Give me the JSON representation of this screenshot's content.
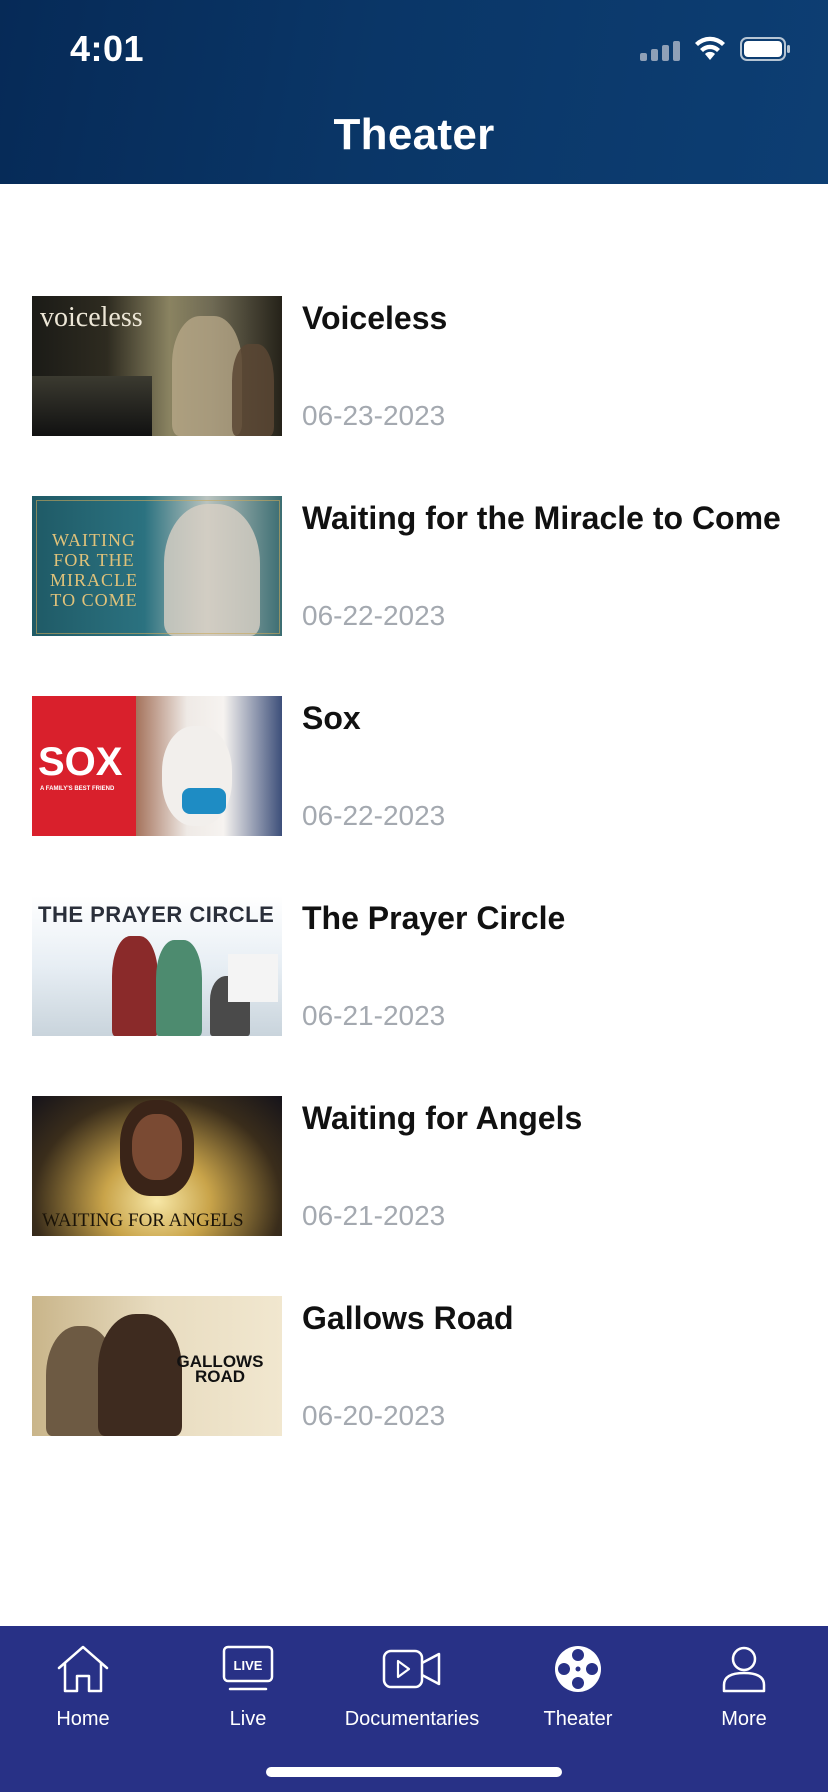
{
  "status_bar": {
    "time": "4:01"
  },
  "header": {
    "title": "Theater"
  },
  "movies": [
    {
      "title": "Voiceless",
      "date": "06-23-2023",
      "thumb_text": "voiceless"
    },
    {
      "title": "Waiting for the Miracle to Come",
      "date": "06-22-2023",
      "thumb_text": "WAITING FOR THE MIRACLE TO COME"
    },
    {
      "title": "Sox",
      "date": "06-22-2023",
      "thumb_text": "SOX",
      "thumb_subtext": "A FAMILY'S BEST FRIEND"
    },
    {
      "title": "The Prayer Circle",
      "date": "06-21-2023",
      "thumb_text": "THE PRAYER CIRCLE"
    },
    {
      "title": "Waiting for Angels",
      "date": "06-21-2023",
      "thumb_text": "WAITING FOR ANGELS"
    },
    {
      "title": "Gallows Road",
      "date": "06-20-2023",
      "thumb_text": "GALLOWS ROAD"
    }
  ],
  "tabbar": {
    "items": [
      {
        "label": "Home",
        "icon": "home-icon"
      },
      {
        "label": "Live",
        "icon": "live-tv-icon",
        "badge": "LIVE"
      },
      {
        "label": "Documentaries",
        "icon": "video-camera-icon"
      },
      {
        "label": "Theater",
        "icon": "film-reel-icon",
        "active": true
      },
      {
        "label": "More",
        "icon": "user-icon"
      }
    ]
  },
  "colors": {
    "header_bg": "#0a3667",
    "tabbar_bg": "#283186",
    "date_text": "#a4a9b0"
  }
}
